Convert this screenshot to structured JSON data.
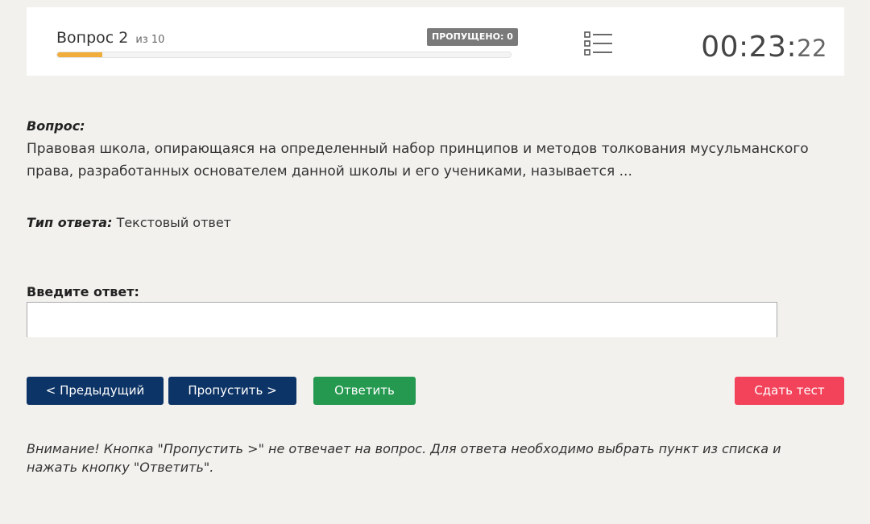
{
  "header": {
    "question_label": "Вопрос 2",
    "question_of": "из 10",
    "skipped_badge": "ПРОПУЩЕНО: 0",
    "progress": 0.1,
    "progress_color": "#f0ad3c",
    "list_icon": "list-icon",
    "timer": {
      "main": "00:23:",
      "seconds": "22"
    }
  },
  "question": {
    "label": "Вопрос:",
    "text": "Правовая школа, опирающаяся на определенный набор принципов и методов толкования мусульманского права, разработанных основателем данной школы и его учениками, называется ..."
  },
  "answer_type": {
    "label": "Тип ответа:",
    "value": "Текстовый ответ"
  },
  "answer_input": {
    "label": "Введите ответ:",
    "value": "",
    "placeholder": ""
  },
  "buttons": {
    "prev": "< Предыдущий",
    "skip": "Пропустить >",
    "answer": "Ответить",
    "finish": "Сдать тест"
  },
  "colors": {
    "nav_button": "#0d3466",
    "answer_button": "#24994f",
    "finish_button": "#f2435a",
    "badge": "#7a7a7a"
  },
  "warning": "Внимание! Кнопка \"Пропустить >\" не отвечает на вопрос. Для ответа необходимо выбрать пункт из списка и нажать кнопку \"Ответить\"."
}
